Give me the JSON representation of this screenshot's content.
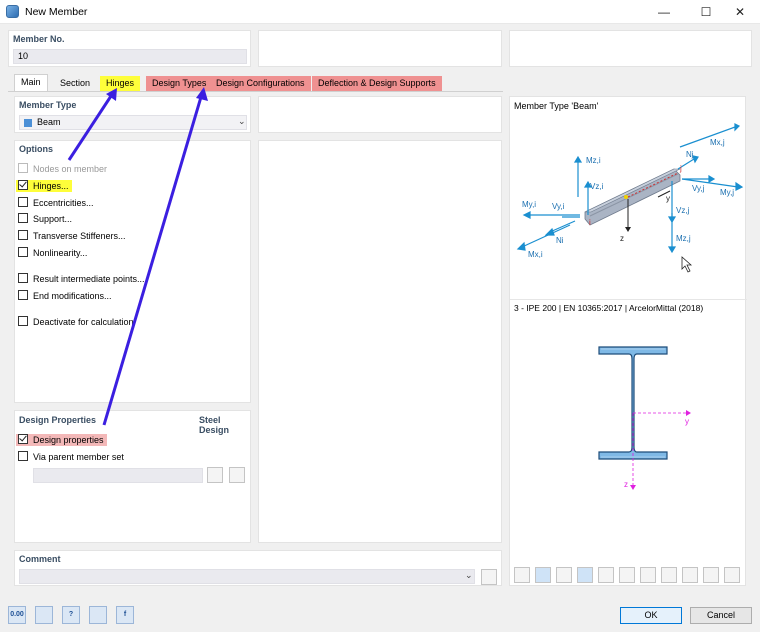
{
  "window": {
    "title": "New Member",
    "minimize_glyph": "—",
    "maximize_glyph": "☐",
    "close_glyph": "✕"
  },
  "member_no": {
    "label": "Member No.",
    "value": "10"
  },
  "tabs": [
    {
      "label": "Main",
      "active": true,
      "highlight": "none"
    },
    {
      "label": "Section",
      "active": false,
      "highlight": "none"
    },
    {
      "label": "Hinges",
      "active": false,
      "highlight": "#fefe3a"
    },
    {
      "label": "Design Types",
      "active": false,
      "highlight": "#ef9191"
    },
    {
      "label": "Design Configurations",
      "active": false,
      "highlight": "#ef9191"
    },
    {
      "label": "Deflection & Design Supports",
      "active": false,
      "highlight": "#ef9191"
    }
  ],
  "member_type": {
    "label": "Member Type",
    "value": "Beam",
    "swatch_color": "#4b8fd6"
  },
  "options": {
    "label": "Options",
    "items": [
      {
        "label": "Nodes on member",
        "checked": false,
        "enabled": false
      },
      {
        "label": "Hinges...",
        "checked": true,
        "enabled": true,
        "highlight": "yellow"
      },
      {
        "label": "Eccentricities...",
        "checked": false,
        "enabled": true
      },
      {
        "label": "Support...",
        "checked": false,
        "enabled": true
      },
      {
        "label": "Transverse Stiffeners...",
        "checked": false,
        "enabled": true
      },
      {
        "label": "Nonlinearity...",
        "checked": false,
        "enabled": true
      },
      {
        "label": "Result intermediate points...",
        "checked": false,
        "enabled": true
      },
      {
        "label": "End modifications...",
        "checked": false,
        "enabled": true
      },
      {
        "label": "Deactivate for calculation",
        "checked": false,
        "enabled": true
      }
    ]
  },
  "design_properties": {
    "label": "Design Properties",
    "addon": "Steel Design",
    "items": [
      {
        "label": "Design properties",
        "checked": true,
        "highlight": "red"
      },
      {
        "label": "Via parent member set",
        "checked": false
      }
    ]
  },
  "comment": {
    "label": "Comment",
    "value": ""
  },
  "preview": {
    "member_type_caption": "Member Type 'Beam'",
    "section_caption": "3 - IPE 200 | EN 10365:2017 | ArcelorMittal (2018)",
    "beam_labels": [
      "Mz,i",
      "Mx,j",
      "Nj",
      "Vz,i",
      "j",
      "My,j",
      "Vy,j",
      "My,i",
      "Vy,i",
      "y",
      "Vz,j",
      "i",
      "Ni",
      "Mx,i",
      "z",
      "Mz,j"
    ],
    "section_axes": {
      "y": "y",
      "z": "z"
    },
    "beam_color": "#1a8fd0",
    "section_color": "#7fb9e6"
  },
  "buttons": {
    "ok": "OK",
    "cancel": "Cancel"
  },
  "bottom_tools": [
    {
      "name": "units-icon",
      "text": "0.00"
    },
    {
      "name": "member-icon",
      "text": ""
    },
    {
      "name": "help-icon",
      "text": "?"
    },
    {
      "name": "delete-icon",
      "text": ""
    },
    {
      "name": "formula-icon",
      "text": "f"
    }
  ],
  "annotations": {
    "arrow_color": "#3b1fe0"
  }
}
